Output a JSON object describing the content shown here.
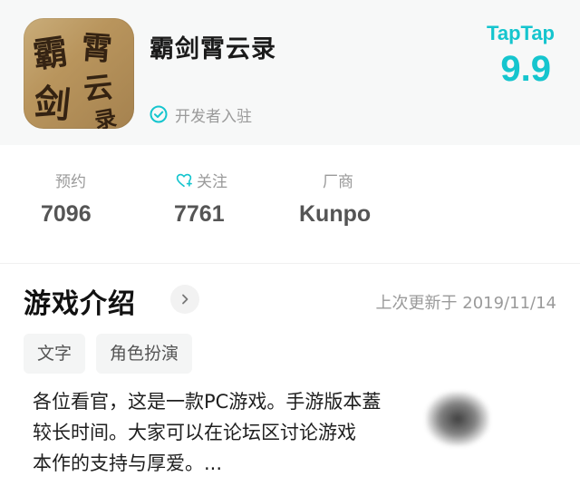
{
  "app": {
    "title": "霸剑霄云录",
    "developer_badge": "开发者入驻",
    "icon_glyphs": [
      "霸",
      "剑",
      "霄",
      "云",
      "录"
    ]
  },
  "store": {
    "logo_text": "TapTap",
    "rating": "9.9"
  },
  "stats": [
    {
      "label": "预约",
      "value": "7096",
      "icon": ""
    },
    {
      "label": "关注",
      "value": "7761",
      "icon": "heart-plus-icon"
    },
    {
      "label": "厂商",
      "value": "Kunpo",
      "icon": ""
    }
  ],
  "section": {
    "title": "游戏介绍",
    "last_updated": "上次更新于 2019/11/14"
  },
  "tags": [
    "文字",
    "角色扮演"
  ],
  "description": {
    "lines": [
      "各位看官，这是一款PC游戏。手游版本蓋",
      "较长时间。大家可以在论坛区讨论游戏",
      "本作的支持与厚爱。..."
    ]
  },
  "colors": {
    "accent": "#15c5ce",
    "muted_text": "#9a9a9a",
    "header_bg": "#f7f8f8"
  }
}
